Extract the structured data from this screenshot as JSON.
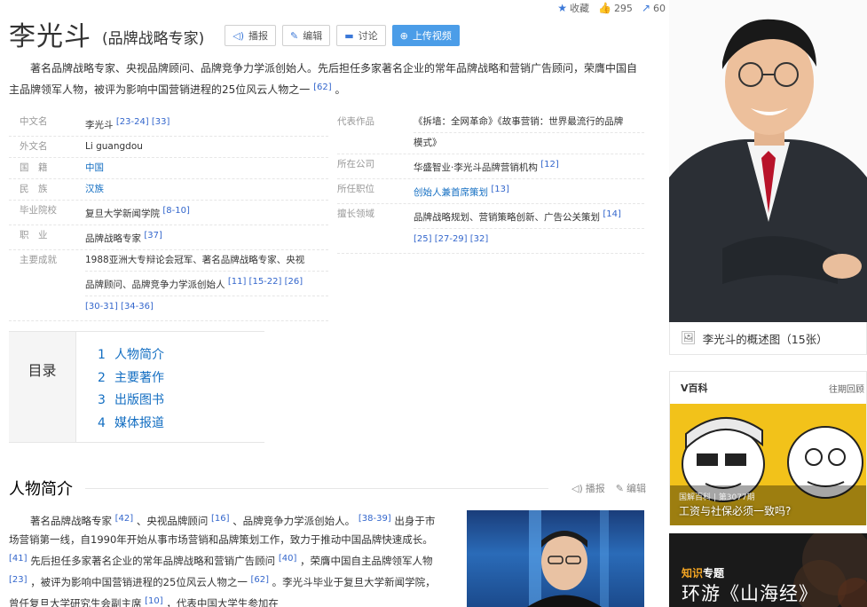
{
  "top_stats": {
    "collect_label": "收藏",
    "likes": "295",
    "shares": "60"
  },
  "title": {
    "name": "李光斗",
    "subtitle": "(品牌战略专家)"
  },
  "buttons": {
    "broadcast": "播报",
    "edit": "编辑",
    "discuss": "讨论",
    "upload_video": "上传视频"
  },
  "summary": {
    "text": "著名品牌战略专家、央视品牌顾问、品牌竞争力学派创始人。先后担任多家著名企业的常年品牌战略和营销广告顾问，荣膺中国自主品牌领军人物，被评为影响中国营销进程的25位风云人物之一",
    "ref": "[62]",
    "end": "。"
  },
  "infobox": {
    "left": [
      {
        "name": "中文名",
        "value": "李光斗",
        "refs": "[23-24]  [33]"
      },
      {
        "name": "外文名",
        "value": "Li guangdou",
        "refs": ""
      },
      {
        "name": "国　籍",
        "value": "中国",
        "refs": ""
      },
      {
        "name": "民　族",
        "value": "汉族",
        "refs": ""
      },
      {
        "name": "毕业院校",
        "value": "复旦大学新闻学院",
        "refs": "[8-10]"
      },
      {
        "name": "职　业",
        "value": "品牌战略专家",
        "refs": "[37]"
      }
    ],
    "achievement": {
      "name": "主要成就",
      "line1": "1988亚洲大专辩论会冠军、著名品牌战略专家、央视",
      "line2": "品牌顾问、品牌竞争力学派创始人",
      "line2_refs": "[11]  [15-22]  [26]",
      "line3_refs": "[30-31]  [34-36]"
    },
    "right": {
      "works_name": "代表作品",
      "works_line1": "《拆墙：全网革命》《故事营销：世界最流行的品牌",
      "works_line2": "模式》",
      "company_name": "所在公司",
      "company_value": "华盛智业·李光斗品牌营销机构",
      "company_refs": "[12]",
      "position_name": "所任职位",
      "position_value": "创始人兼首席策划",
      "position_refs": "[13]",
      "field_name": "擅长领域",
      "field_value": "品牌战略规划、营销策略创新、广告公关策划",
      "field_refs": "[14]",
      "field_refs2": "[25]  [27-29]  [32]"
    }
  },
  "toc": {
    "title": "目录",
    "items": [
      {
        "num": "1",
        "label": "人物简介"
      },
      {
        "num": "2",
        "label": "主要著作"
      },
      {
        "num": "3",
        "label": "出版图书"
      },
      {
        "num": "4",
        "label": "媒体报道"
      }
    ]
  },
  "section": {
    "title": "人物简介",
    "broadcast": "播报",
    "edit": "编辑",
    "p1": "著名品牌战略专家",
    "r1": "[42]",
    "p2": "、央视品牌顾问",
    "r2": "[16]",
    "p3": "、品牌竞争力学派创始人。",
    "r3": "[38-39]",
    "p4": "出身于市场营销第一线，自1990年开始从事市场营销和品牌策划工作，致力于推动中国品牌快速成长。",
    "r4": "[41]",
    "p5": "先后担任多家著名企业的常年品牌战略和营销广告顾问",
    "r5": "[40]",
    "p6": "，荣膺中国自主品牌领军人物",
    "r6": "[23]",
    "p7": "，被评为影响中国营销进程的25位风云人物之一",
    "r7": "[62]",
    "p8": "。李光斗毕业于复旦大学新闻学院，曾任复旦大学研究生会副主席",
    "r8": "[10]",
    "p9": "，代表中国大学生参加在"
  },
  "sidebar": {
    "pic_caption": "李光斗的概述图（15张）",
    "vbaike_title": "V百科",
    "vbaike_more": "往期回顾",
    "vbaike_sub": "国解百科 | 第3077期",
    "vbaike_caption": "工资与社保必须一致吗?",
    "zhishi_tag1": "知识",
    "zhishi_tag2": "专题",
    "zhishi_title": "环游《山海经》"
  }
}
